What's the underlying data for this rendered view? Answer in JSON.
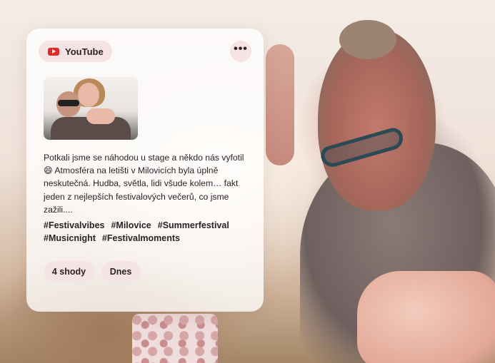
{
  "post": {
    "source": {
      "label": "YouTube",
      "icon": "youtube-icon",
      "brand_color": "#e12a2a"
    },
    "more_icon": "more-horizontal-icon",
    "more_label": "•••",
    "text": "Potkali jsme se náhodou u stage a někdo nás vyfotil 😄 Atmosféra na letišti v Milovicích byla úplně neskutečná. Hudba, světla, lidi všude kolem… fakt jeden z nejlepších festivalových večerů, co jsme zažili....",
    "hashtags": [
      "#Festivalvibes",
      "#Milovice",
      "#Summerfestival",
      "#Musicnight",
      "#Festivalmoments"
    ],
    "matches_label": "4 shody",
    "date_label": "Dnes"
  },
  "colors": {
    "chip_bg": "#f6e3e3",
    "text": "#2a2326"
  }
}
